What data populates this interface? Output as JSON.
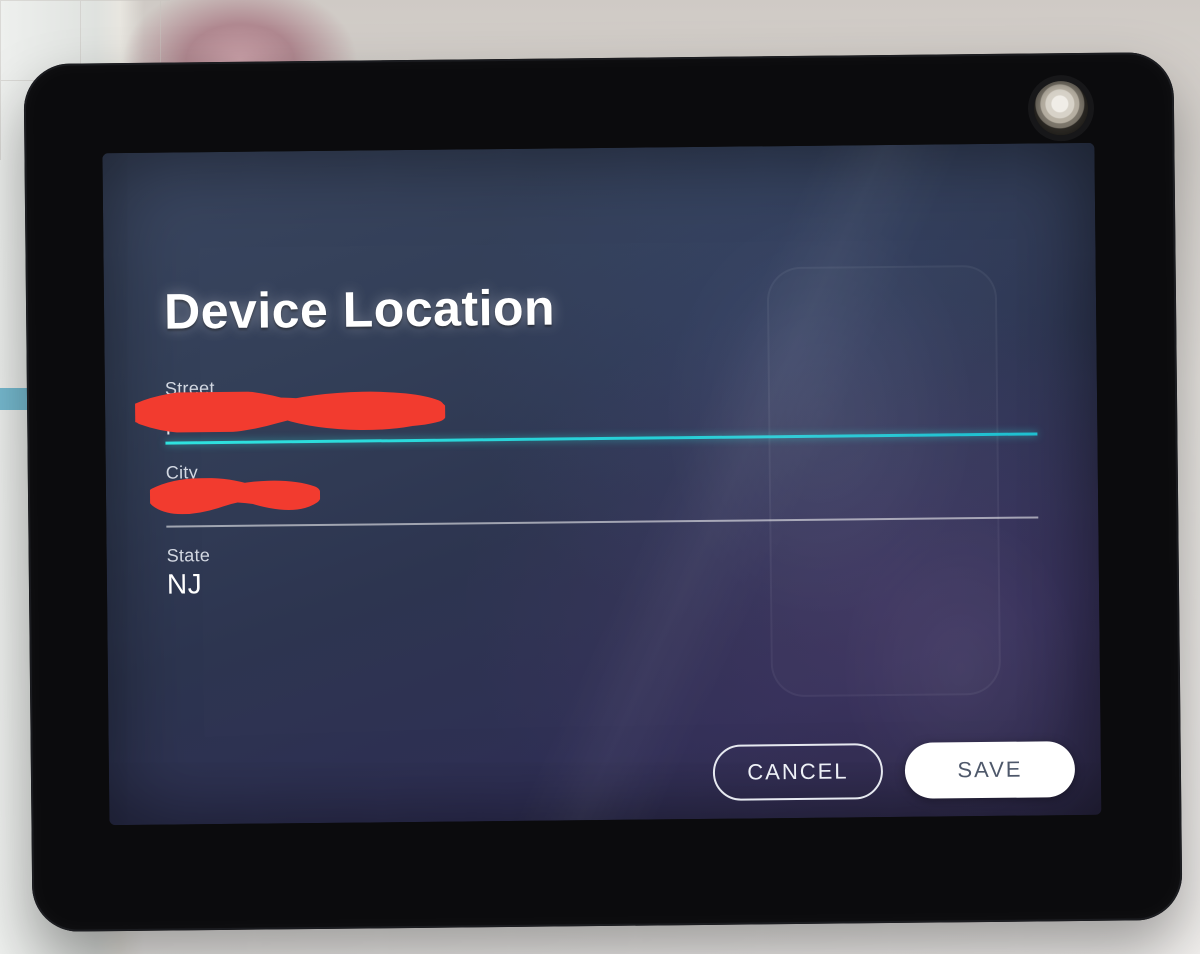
{
  "title": "Device Location",
  "fields": {
    "street": {
      "label": "Street",
      "value": "",
      "focused": true,
      "redacted": true
    },
    "city": {
      "label": "City",
      "value": "",
      "focused": false,
      "redacted": true
    },
    "state": {
      "label": "State",
      "value": "NJ",
      "focused": false,
      "redacted": false
    }
  },
  "actions": {
    "cancel": "CANCEL",
    "save": "SAVE"
  },
  "colors": {
    "focus_underline": "#2fe3df",
    "redaction": "#f23b2f"
  }
}
